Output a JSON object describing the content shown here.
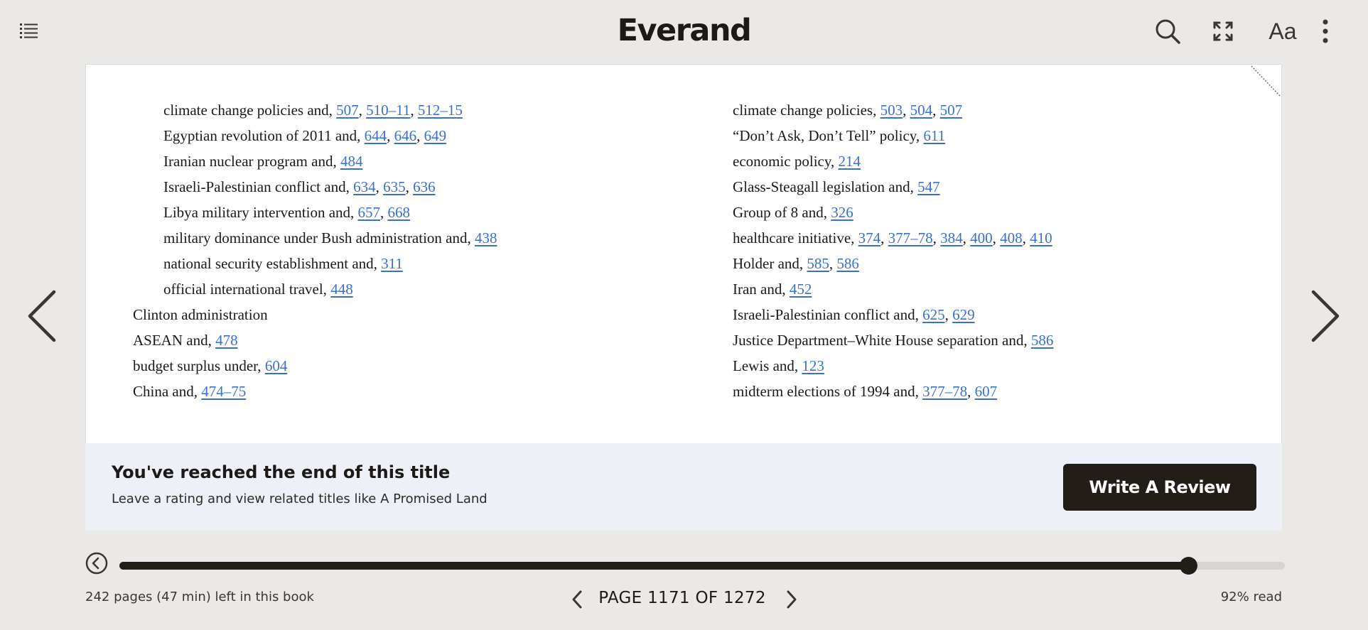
{
  "header": {
    "logo": "Everand",
    "icons": {
      "toc": "list-icon",
      "search": "search-icon",
      "fullscreen": "expand-icon",
      "font": "Aa",
      "more": "more-vertical-icon"
    }
  },
  "content": {
    "left_column": [
      {
        "text": "climate change policies and, ",
        "indent": true,
        "links": [
          "507",
          "510–11",
          "512–15"
        ]
      },
      {
        "text": "Egyptian revolution of 2011 and, ",
        "indent": true,
        "links": [
          "644",
          "646",
          "649"
        ]
      },
      {
        "text": "Iranian nuclear program and, ",
        "indent": true,
        "links": [
          "484"
        ]
      },
      {
        "text": "Israeli-Palestinian conflict and, ",
        "indent": true,
        "links": [
          "634",
          "635",
          "636"
        ]
      },
      {
        "text": "Libya military intervention and, ",
        "indent": true,
        "links": [
          "657",
          "668"
        ]
      },
      {
        "text": "military dominance under Bush administration and, ",
        "indent": true,
        "links": [
          "438"
        ]
      },
      {
        "text": "national security establishment and, ",
        "indent": true,
        "links": [
          "311"
        ]
      },
      {
        "text": "official international travel, ",
        "indent": true,
        "links": [
          "448"
        ]
      },
      {
        "text": "Clinton administration",
        "indent": false,
        "links": []
      },
      {
        "text": "ASEAN and, ",
        "indent": false,
        "links": [
          "478"
        ]
      },
      {
        "text": "budget surplus under, ",
        "indent": false,
        "links": [
          "604"
        ]
      },
      {
        "text": "China and, ",
        "indent": false,
        "links": [
          "474–75"
        ]
      }
    ],
    "right_column": [
      {
        "text": "climate change policies, ",
        "indent": false,
        "links": [
          "503",
          "504",
          "507"
        ]
      },
      {
        "text": "“Don’t Ask, Don’t Tell” policy, ",
        "indent": false,
        "links": [
          "611"
        ]
      },
      {
        "text": "economic policy, ",
        "indent": false,
        "links": [
          "214"
        ]
      },
      {
        "text": "Glass-Steagall legislation and, ",
        "indent": false,
        "links": [
          "547"
        ]
      },
      {
        "text": "Group of 8 and, ",
        "indent": false,
        "links": [
          "326"
        ]
      },
      {
        "text": "healthcare initiative, ",
        "indent": false,
        "links": [
          "374",
          "377–78",
          "384",
          "400",
          "408",
          "410"
        ]
      },
      {
        "text": "Holder and, ",
        "indent": false,
        "links": [
          "585",
          "586"
        ]
      },
      {
        "text": "Iran and, ",
        "indent": false,
        "links": [
          "452"
        ]
      },
      {
        "text": "Israeli-Palestinian conflict and, ",
        "indent": false,
        "links": [
          "625",
          "629"
        ]
      },
      {
        "text": "Justice Department–White House separation and, ",
        "indent": false,
        "links": [
          "586"
        ]
      },
      {
        "text": "Lewis and, ",
        "indent": false,
        "links": [
          "123"
        ]
      },
      {
        "text": "midterm elections of 1994 and, ",
        "indent": false,
        "links": [
          "377–78",
          "607"
        ]
      }
    ]
  },
  "banner": {
    "title": "You've reached the end of this title",
    "subtitle": "Leave a rating and view related titles like A Promised Land",
    "button_label": "Write A Review"
  },
  "progress": {
    "fraction": 0.917,
    "pages_left_text": "242 pages (47 min) left in this book",
    "page_label": "PAGE 1171 OF 1272",
    "percent_read_text": "92% read"
  },
  "colors": {
    "background": "#eae9e7",
    "link": "#3a6fd0",
    "dark": "#221d17",
    "banner": "#edf0f7"
  }
}
